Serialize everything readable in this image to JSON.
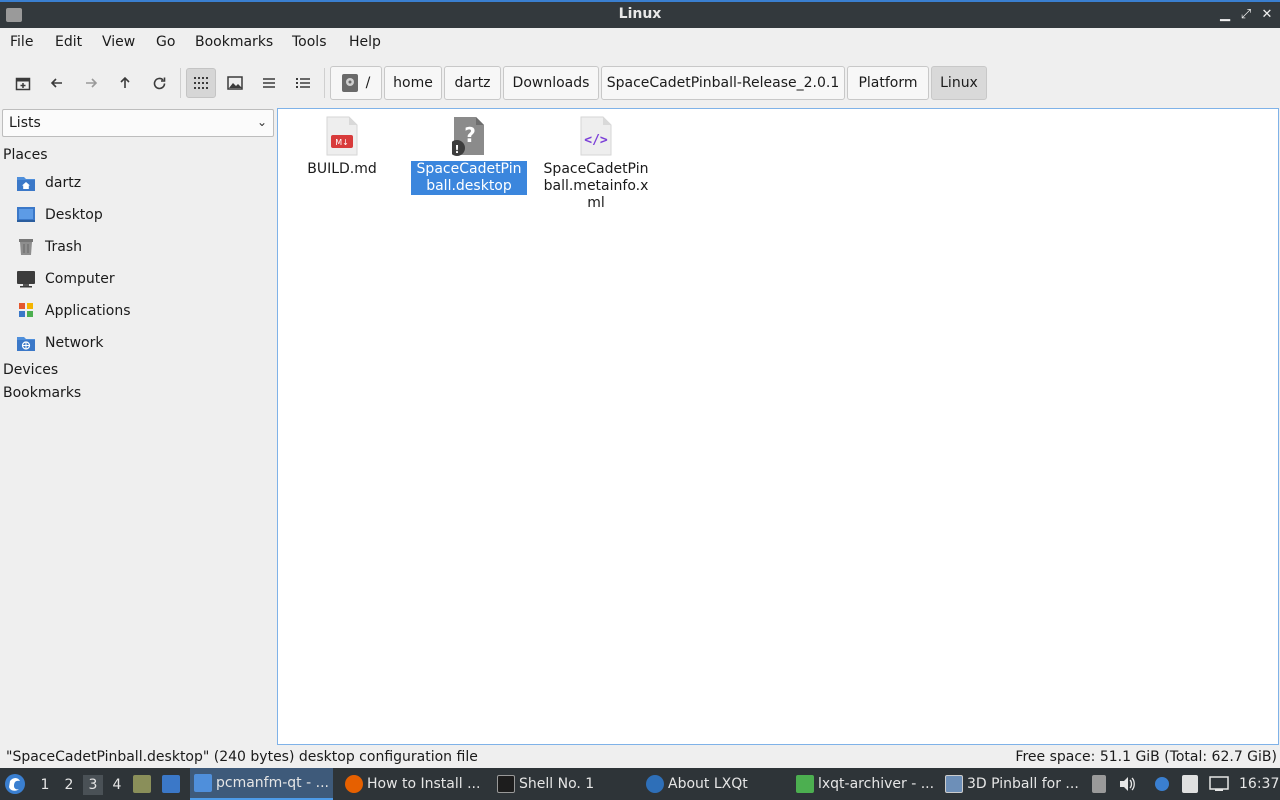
{
  "window": {
    "title": "Linux",
    "controls": {
      "minimize": "▁",
      "maximize": "⤢",
      "close": "✕"
    }
  },
  "menubar": [
    "File",
    "Edit",
    "View",
    "Go",
    "Bookmarks",
    "Tools",
    "Help"
  ],
  "toolbar": {
    "buttons": [
      "new-window-icon",
      "back-icon",
      "forward-icon",
      "up-icon",
      "reload-icon"
    ],
    "view_modes": [
      "icon-view",
      "thumbnail-view",
      "compact-view",
      "detailed-list-view"
    ],
    "active_view": "icon-view"
  },
  "breadcrumb": {
    "root": "/",
    "parts": [
      "home",
      "dartz",
      "Downloads",
      "SpaceCadetPinball-Release_2.0.1",
      "Platform",
      "Linux"
    ]
  },
  "sidebar": {
    "mode": "Lists",
    "places_label": "Places",
    "places": [
      {
        "label": "dartz",
        "icon": "home-folder-icon"
      },
      {
        "label": "Desktop",
        "icon": "desktop-icon"
      },
      {
        "label": "Trash",
        "icon": "trash-icon"
      },
      {
        "label": "Computer",
        "icon": "computer-icon"
      },
      {
        "label": "Applications",
        "icon": "applications-icon"
      },
      {
        "label": "Network",
        "icon": "network-icon"
      }
    ],
    "devices_label": "Devices",
    "bookmarks_label": "Bookmarks"
  },
  "files": [
    {
      "name": "BUILD.md",
      "icon": "markdown-file-icon",
      "selected": false
    },
    {
      "name": "SpaceCadetPinball.desktop",
      "icon": "unknown-file-icon",
      "selected": true
    },
    {
      "name": "SpaceCadetPinball.metainfo.xml",
      "icon": "xml-file-icon",
      "selected": false
    }
  ],
  "status": {
    "left": "\"SpaceCadetPinball.desktop\" (240 bytes) desktop configuration file",
    "right": "Free space: 51.1 GiB (Total: 62.7 GiB)"
  },
  "taskbar": {
    "desktops": [
      "1",
      "2",
      "3",
      "4"
    ],
    "active_desktop": "3",
    "tasks": [
      {
        "label": "pcmanfm-qt - ...",
        "icon": "folder-icon",
        "active": true
      },
      {
        "label": "How to Install ...",
        "icon": "firefox-icon",
        "active": false
      },
      {
        "label": "Shell No. 1",
        "icon": "terminal-icon",
        "active": false
      },
      {
        "label": "About LXQt",
        "icon": "lxqt-icon",
        "active": false
      },
      {
        "label": "lxqt-archiver - ...",
        "icon": "archive-icon",
        "active": false
      },
      {
        "label": "3D Pinball for ...",
        "icon": "window-icon",
        "active": false
      }
    ],
    "clock": "16:37"
  },
  "colors": {
    "selection": "#3b86dd",
    "titlebar": "#33393d",
    "taskbar": "#2e3438",
    "accent": "#3a7fd0"
  }
}
